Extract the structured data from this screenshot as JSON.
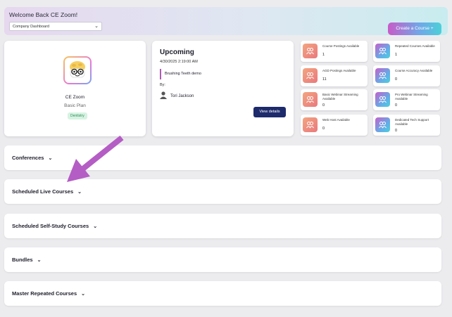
{
  "banner": {
    "welcome": "Welcome Back CE Zoom!",
    "dashboard_select": "Company Dashboard",
    "create_button": "Create a Course +"
  },
  "profile": {
    "name": "CE Zoom",
    "plan": "Basic Plan",
    "badge": "Dentistry"
  },
  "upcoming": {
    "title": "Upcoming",
    "datetime": "4/30/2025 2:19:00 AM",
    "event": "Brushing Teeth demo",
    "by_label": "By:",
    "person": "Tori Jackson",
    "view_button": "View details"
  },
  "stats": [
    {
      "label": "Course Postings Available",
      "value": "1",
      "style": "warm"
    },
    {
      "label": "Repeated Courses Available",
      "value": "1",
      "style": "cool"
    },
    {
      "label": "AGD Postings Available",
      "value": "11",
      "style": "warm"
    },
    {
      "label": "Course Accuracy Available",
      "value": "0",
      "style": "cool"
    },
    {
      "label": "Basic Webinar Streaming Available",
      "value": "0",
      "style": "warm"
    },
    {
      "label": "Pro Webinar Streaming Available",
      "value": "0",
      "style": "cool"
    },
    {
      "label": "Web Host Available",
      "value": "0",
      "style": "warm"
    },
    {
      "label": "Dedicated Tech Support Available",
      "value": "0",
      "style": "cool"
    }
  ],
  "sections": [
    {
      "label": "Conferences"
    },
    {
      "label": "Scheduled Live Courses"
    },
    {
      "label": "Scheduled Self-Study Courses"
    },
    {
      "label": "Bundles"
    },
    {
      "label": "Master Repeated Courses"
    }
  ],
  "colors": {
    "accent_purple": "#b05ab5",
    "button_navy": "#1d2a6b",
    "arrow": "#b45dc4"
  }
}
